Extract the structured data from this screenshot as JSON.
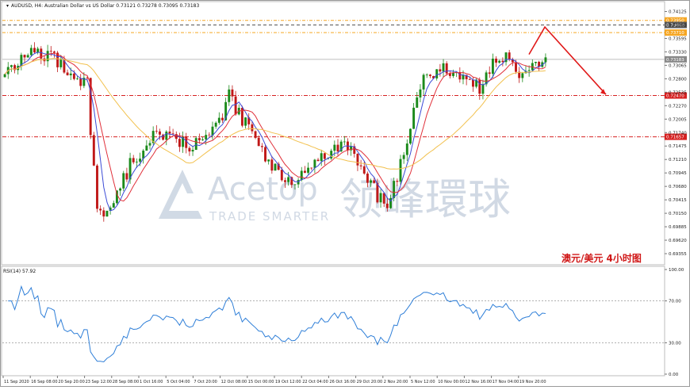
{
  "header": {
    "symbol_info": "AUDUSD, H4: Australian Dollar vs US Dollar  0.73121 0.73278 0.73095 0.73183"
  },
  "watermark": {
    "brand_en": "Acetop",
    "brand_cn": "领峰環球",
    "tagline": "TRADE SMARTER"
  },
  "annotation": {
    "cn_label": "澳元/美元  4小时图"
  },
  "colors": {
    "bull": "#1a8a1a",
    "bear": "#c01818",
    "ma_fast": "#3b4bd6",
    "ma_mid": "#e0303a",
    "ma_slow": "#f2c14e",
    "rsi": "#2f7fd8",
    "resistance_line": "#f5a623",
    "support_line": "#d62020",
    "arrow": "#e01818",
    "grid_dash": "#555555",
    "watermark": "#c9d3e0"
  },
  "chart_data": [
    {
      "type": "candlestick",
      "title": "AUDUSD, H4",
      "y_ticks": [
        "0.74125",
        "0.73860",
        "0.73595",
        "0.73330",
        "0.73065",
        "0.72800",
        "0.72535",
        "0.72270",
        "0.72005",
        "0.71740",
        "0.71475",
        "0.71210",
        "0.70945",
        "0.70680",
        "0.70415",
        "0.70150",
        "0.69885",
        "0.69620",
        "0.69355"
      ],
      "ylim": [
        0.69355,
        0.7418
      ],
      "x_labels": [
        "11 Sep 2020",
        "16 Sep 08:00",
        "20 Sep 20:00",
        "23 Sep 12:00",
        "28 Sep 08:00",
        "1 Oct 16:00",
        "5 Oct 04:00",
        "7 Oct 20:00",
        "12 Oct 08:00",
        "15 Oct 00:00",
        "19 Oct 12:00",
        "22 Oct 04:00",
        "26 Oct 16:00",
        "29 Oct 20:00",
        "2 Nov 20:00",
        "5 Nov 12:00",
        "10 Nov 00:00",
        "12 Nov 16:00",
        "17 Nov 04:00",
        "19 Nov 20:00"
      ],
      "candle_count": 165,
      "price_path": [
        [
          0,
          0.729
        ],
        [
          8,
          0.7338
        ],
        [
          15,
          0.732
        ],
        [
          25,
          0.727
        ],
        [
          28,
          0.701
        ],
        [
          32,
          0.703
        ],
        [
          38,
          0.711
        ],
        [
          46,
          0.718
        ],
        [
          55,
          0.7148
        ],
        [
          60,
          0.716
        ],
        [
          64,
          0.718
        ],
        [
          68,
          0.7245
        ],
        [
          74,
          0.718
        ],
        [
          82,
          0.71
        ],
        [
          88,
          0.708
        ],
        [
          96,
          0.7135
        ],
        [
          104,
          0.7145
        ],
        [
          108,
          0.71
        ],
        [
          116,
          0.702
        ],
        [
          122,
          0.716
        ],
        [
          127,
          0.729
        ],
        [
          134,
          0.73
        ],
        [
          144,
          0.7262
        ],
        [
          150,
          0.733
        ],
        [
          157,
          0.729
        ],
        [
          164,
          0.732
        ]
      ],
      "horizontal_levels": [
        {
          "price": 0.7395,
          "label": "0.73950",
          "style": "resistance"
        },
        {
          "price": 0.7386,
          "label": "0.73860",
          "style": "neutral"
        },
        {
          "price": 0.7371,
          "label": "0.73710",
          "style": "resistance"
        },
        {
          "price": 0.73183,
          "label": "0.73183",
          "style": "current"
        },
        {
          "price": 0.7247,
          "label": "0.72470",
          "style": "support"
        },
        {
          "price": 0.71657,
          "label": "0.71657",
          "style": "support"
        }
      ],
      "forecast_path": [
        [
          0.7328
        ],
        [
          0.7382
        ],
        [
          0.7249
        ]
      ]
    },
    {
      "type": "line",
      "title": "RSI(14) 57.92",
      "ylim": [
        0,
        100
      ],
      "y_ticks": [
        "100.00",
        "70.00",
        "30.00",
        "0.00"
      ],
      "levels": [
        70,
        30
      ],
      "current_value": 57.92
    }
  ]
}
